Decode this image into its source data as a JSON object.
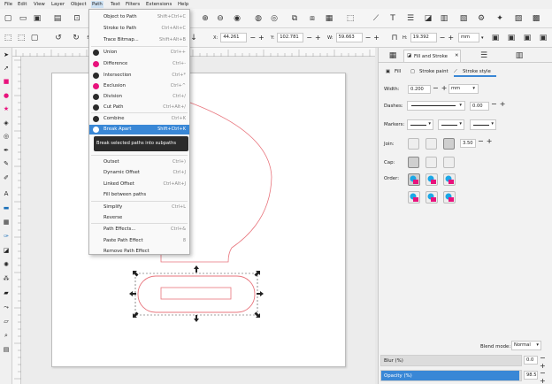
{
  "menubar": [
    "File",
    "Edit",
    "View",
    "Layer",
    "Object",
    "Path",
    "Text",
    "Filters",
    "Extensions",
    "Help"
  ],
  "ctrl": {
    "x_label": "X:",
    "x": "44.261",
    "y_label": "Y:",
    "y": "102.781",
    "w_label": "W:",
    "w": "59.663",
    "h_label": "H:",
    "h": "19.392",
    "unit": "mm"
  },
  "path_menu": {
    "items": [
      {
        "label": "Object to Path",
        "shortcut": "Shift+Ctrl+C"
      },
      {
        "label": "Stroke to Path",
        "shortcut": "Ctrl+Alt+C"
      },
      {
        "label": "Trace Bitmap...",
        "shortcut": "Shift+Alt+B"
      },
      {
        "label": "Union",
        "shortcut": "Ctrl++"
      },
      {
        "label": "Difference",
        "shortcut": "Ctrl+-"
      },
      {
        "label": "Intersection",
        "shortcut": "Ctrl+*"
      },
      {
        "label": "Exclusion",
        "shortcut": "Ctrl+^"
      },
      {
        "label": "Division",
        "shortcut": "Ctrl+/"
      },
      {
        "label": "Cut Path",
        "shortcut": "Ctrl+Alt+/"
      },
      {
        "label": "Combine",
        "shortcut": "Ctrl+K"
      },
      {
        "label": "Break Apart",
        "shortcut": "Shift+Ctrl+K"
      },
      {
        "label": "Outset",
        "shortcut": "Ctrl+)"
      },
      {
        "label": "Dynamic Offset",
        "shortcut": "Ctrl+J"
      },
      {
        "label": "Linked Offset",
        "shortcut": "Ctrl+Alt+J"
      },
      {
        "label": "Fill between paths",
        "shortcut": ""
      },
      {
        "label": "Simplify",
        "shortcut": "Ctrl+L"
      },
      {
        "label": "Reverse",
        "shortcut": ""
      },
      {
        "label": "Path Effects...",
        "shortcut": "Ctrl+&"
      },
      {
        "label": "Paste Path Effect",
        "shortcut": "8"
      },
      {
        "label": "Remove Path Effect",
        "shortcut": ""
      }
    ],
    "tooltip": "Break selected paths into subpaths"
  },
  "dock": {
    "tab_title": "Fill and Stroke",
    "subtabs": [
      "Fill",
      "Stroke paint",
      "Stroke style"
    ],
    "width_label": "Width:",
    "width_value": "0.200",
    "width_unit": "mm",
    "dashes_label": "Dashes:",
    "dashes_value": "0.00",
    "markers_label": "Markers:",
    "join_label": "Join:",
    "join_value": "3.50",
    "cap_label": "Cap:",
    "order_label": "Order:",
    "blend_label": "Blend mode:",
    "blend_value": "Normal",
    "blur_label": "Blur (%)",
    "blur_value": "0.0",
    "opacity_label": "Opacity (%)",
    "opacity_value": "98.5",
    "opacity_fraction": 0.985
  },
  "colors": {
    "accent": "#3987d6",
    "shape_stroke": "#e8747c",
    "cyan": "#1aa7e6",
    "magenta": "#e8127c"
  }
}
